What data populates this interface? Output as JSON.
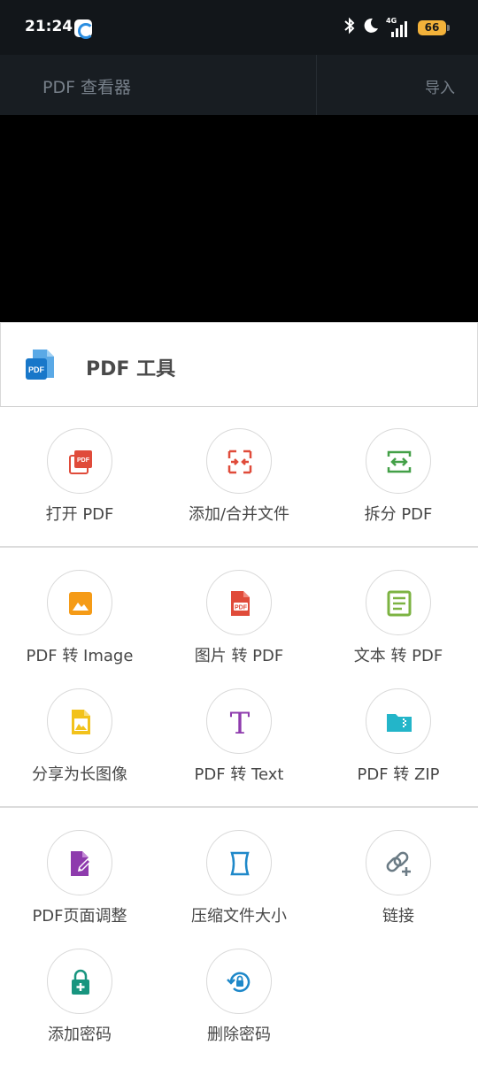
{
  "status_bar": {
    "time": "21:24",
    "network": "4G",
    "battery": "66"
  },
  "app_bar": {
    "title": "PDF 查看器",
    "action": "导入"
  },
  "sheet": {
    "title": "PDF 工具",
    "sections": [
      {
        "tools": [
          {
            "label": "打开 PDF",
            "icon": "open-pdf-icon",
            "color": "#e04b3a"
          },
          {
            "label": "添加/合并文件",
            "icon": "merge-icon",
            "color": "#e04b3a"
          },
          {
            "label": "拆分 PDF",
            "icon": "split-icon",
            "color": "#43a047"
          }
        ]
      },
      {
        "tools": [
          {
            "label": "PDF 转 Image",
            "icon": "image-icon",
            "color": "#f59b17"
          },
          {
            "label": "图片 转 PDF",
            "icon": "pdf-file-icon",
            "color": "#e04b3a"
          },
          {
            "label": "文本 转 PDF",
            "icon": "text-doc-icon",
            "color": "#7cb342"
          },
          {
            "label": "分享为长图像",
            "icon": "image-file-icon",
            "color": "#f2c21b"
          },
          {
            "label": "PDF 转 Text",
            "icon": "text-t-icon",
            "color": "#8e3bad"
          },
          {
            "label": "PDF 转 ZIP",
            "icon": "zip-folder-icon",
            "color": "#23b5c9"
          }
        ]
      },
      {
        "tools": [
          {
            "label": "PDF页面调整",
            "icon": "edit-file-icon",
            "color": "#8e3bad"
          },
          {
            "label": "压缩文件大小",
            "icon": "compress-icon",
            "color": "#1e88c9"
          },
          {
            "label": "链接",
            "icon": "add-link-icon",
            "color": "#6b7b85"
          },
          {
            "label": "添加密码",
            "icon": "lock-add-icon",
            "color": "#18957f"
          },
          {
            "label": "删除密码",
            "icon": "lock-reset-icon",
            "color": "#1e88c9"
          }
        ]
      }
    ]
  }
}
